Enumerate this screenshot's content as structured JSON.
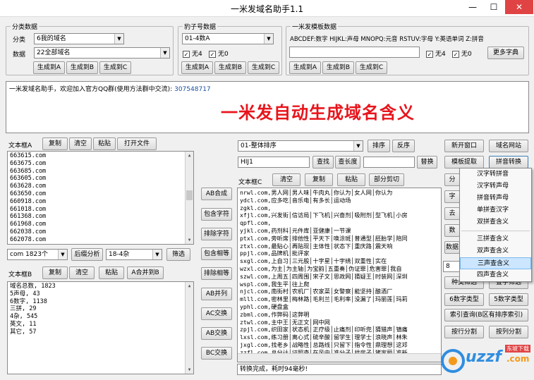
{
  "window": {
    "title": "一米发域名助手1.1",
    "minimize": "—",
    "maximize": "☐",
    "close": "✕",
    "close_bg": "#e04343"
  },
  "group1": {
    "caption": "分类数据",
    "category_label": "分类",
    "category_value": "6我的域名",
    "data_label": "数据",
    "data_value": "22全部域名",
    "btn_a": "生成到A",
    "btn_b": "生成到B",
    "btn_c": "生成到C"
  },
  "group2": {
    "caption": "豹子号数据",
    "select_value": "01-4数A",
    "chk1": "无4",
    "chk2": "无0",
    "btn_a": "生成到A",
    "btn_b": "生成到B",
    "btn_c": "生成到C"
  },
  "group3": {
    "caption": "一米发模板数据",
    "legend": "ABCDEF:数字 HIJKL:声母 MNOPQ:元音 RSTUV:字母 Y:英语单词 Z:拼音",
    "input_value": "",
    "chk1": "无4",
    "chk2": "无0",
    "more_dict": "更多字典",
    "btn_a": "生成到A",
    "btn_b": "生成到B",
    "btn_c": "生成到C"
  },
  "info": {
    "text": "一米发域名助手，欢迎加入官方QQ群(使用方法群中交流):",
    "qq": "307548717",
    "banner": "一米发自动生成域名含义",
    "banner_color": "#e8141b"
  },
  "boxA": {
    "label": "文本框A",
    "copy": "复制",
    "clear": "清空",
    "paste": "粘贴",
    "open": "打开文件",
    "lines": [
      "663615.com",
      "663675.com",
      "663685.com",
      "663605.com",
      "663628.com",
      "663650.com",
      "660918.com",
      "661018.com",
      "661368.com",
      "661968.com",
      "662038.com",
      "662078.com",
      "662608.com"
    ],
    "count_value": "com 1823个",
    "suffix_btn": "后缀分析",
    "range_value": "18-4杂",
    "filter": "筛选"
  },
  "boxB": {
    "label": "文本框B",
    "copy": "复制",
    "clear": "清空",
    "paste": "粘贴",
    "merge": "A合并到B",
    "lines": [
      "域名总数, 1823",
      "5声母, 43",
      "6数字, 1138",
      "三拼, 29",
      "4杂, 545",
      "英文, 11",
      "其它, 57"
    ]
  },
  "midbtns": {
    "ab_merge": "AB合成",
    "contain": "包含字符",
    "exclude": "排除字符",
    "contain_adj": "包含相等",
    "exclude_adj": "排除相等",
    "ab_merge2": "AB并列",
    "ac_swap": "AC交换",
    "ab_swap": "AB交换",
    "bc_swap": "BC交换"
  },
  "sortbar": {
    "sort_value": "01-整体排序",
    "sort": "排序",
    "reverse": "反序",
    "find_value": "HIJ1",
    "find": "查找",
    "find_len": "查长度",
    "replace_value": "",
    "replace": "替换"
  },
  "boxC": {
    "label": "文本框C",
    "clear": "清空",
    "copy": "复制",
    "paste": "粘贴",
    "cut": "部分剪切",
    "rows": [
      "nrwl.com,男人网│男人味│牛肉丸│你认为│女人网│你认为",
      "ydcl.com,应多吃│音乐电│有多长│运动场",
      "zgkl.com,",
      "xfjl.com,兴发街│信访局│下飞机│兴奋剂│吸附剂│型飞机│小房",
      "qpfl.com,",
      "yjkl.com,药剂科│元件库│亚健康│一节课",
      "ptxl.com,旁听席│排他性│平天下│唤涂斑│普通型│胚胎学│陪同",
      "ztxl.com,最贴心│再贴现│主体性│状态下│重庆路│震天响",
      "ppjl.com,品牌机│批评家",
      "sxgl.com,上自习│三元股│十字星│十字绣│双重性│实在",
      "wzxl.com,为主│为主轴│为宝韵│五重奏│伪证罪│危害罪│我自",
      "szwl.com,上周五│四周围│宋子文│思政网│猜疑王│时装网│深圳",
      "wspl.com,我生平│往上爬",
      "njcl.com,南街村│农机厂│农家菜│女警察│能坚持│酿酒厂",
      "mlll.com,密林里│梅林路│毛利兰│毛利率│没漏了│玛丽莲│玛莉",
      "yphl.com,硬盘盒",
      "zbml.com,作弊码│这弊明",
      "ztwl.com,主中王│无正文│网中网",
      "zpjl.com,织田家│状态机│正疗级│止痛剂│印听兜│猜猎声│镇痛",
      "lxsl.com,练习册│离心式│硫辛酸│留学生│理学士│浪晓声│林朱",
      "jxgl.com,找老乡│战略性│总路线│只留下│指令性│鼎理想│这邓",
      "zzfl.com,总分计│证照查│在风中│准分子│找房子│猪家丽│准新",
      "ztdl.com,中途岛│在她的│在特定│擂台大│重特大"
    ],
    "status": "转换完成，耗时94毫秒!"
  },
  "right": {
    "new_window": "新开窗口",
    "domain_site": "域名网站",
    "template": "模板提取",
    "pinyin": "拼音转换",
    "b3": "分",
    "b4": "字",
    "b5": "去",
    "b6": "数",
    "b7": "数据",
    "input8": "8",
    "b9": "种类筛选",
    "b10": "叠字筛选",
    "six_type": "6数字类型",
    "five_type": "5数字类型",
    "index_query": "索引查询(B区有排序索引)",
    "row_split": "按行分割",
    "col_split": "按列分割"
  },
  "menu": {
    "items": [
      "汉字转拼音",
      "汉字转声母",
      "拼音转声母",
      "单拼查汉字",
      "双拼查含义",
      "三拼查含义",
      "双声查含义",
      "三声查含义",
      "四声查含义"
    ],
    "highlight_index": 7,
    "highlight_color": "#cce6ff"
  },
  "watermark": {
    "logo": "uzzf",
    "com": ".com",
    "sub": "东坡下载"
  }
}
